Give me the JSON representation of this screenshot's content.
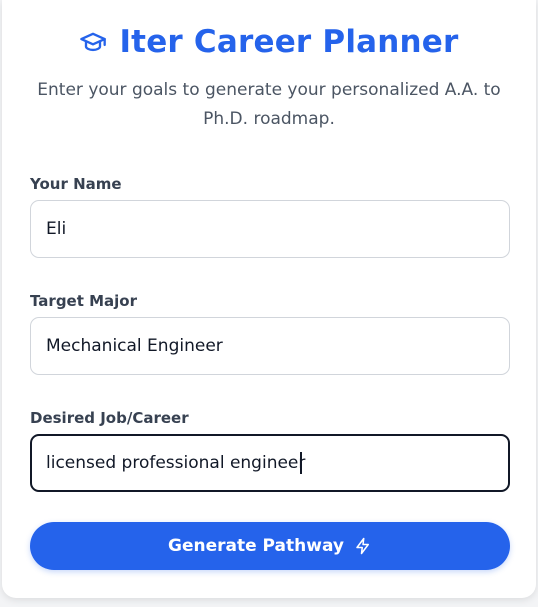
{
  "header": {
    "title": "Iter Career Planner",
    "subtitle": "Enter your goals to generate your personalized A.A. to Ph.D. roadmap.",
    "icon": "graduation-cap-icon"
  },
  "form": {
    "name": {
      "label": "Your Name",
      "value": "Eli"
    },
    "major": {
      "label": "Target Major",
      "value": "Mechanical Engineer"
    },
    "career": {
      "label": "Desired Job/Career",
      "value": "licensed professional engineer"
    },
    "submit": {
      "label": "Generate Pathway",
      "icon": "lightning-bolt-icon"
    }
  },
  "colors": {
    "accent": "#2563eb",
    "text": "#374151",
    "muted": "#4b5563",
    "border": "#d1d5db"
  }
}
